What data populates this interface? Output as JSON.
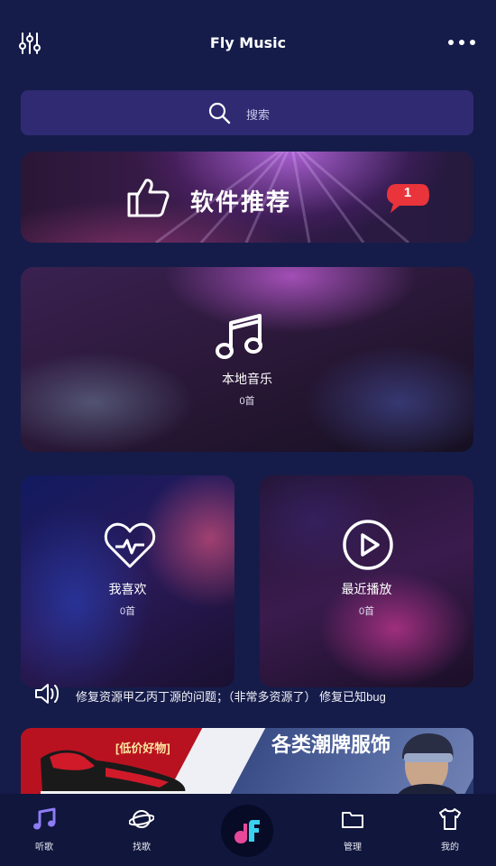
{
  "app": {
    "title": "Fly Music"
  },
  "icons": {
    "equalizer": "equalizer-icon",
    "more": "more-dots-icon",
    "search": "search-icon",
    "thumbs_up": "thumbs-up-icon",
    "music_note": "music-note-icon",
    "heart_pulse": "heart-pulse-icon",
    "play_circle": "play-circle-icon",
    "speaker": "speaker-icon"
  },
  "search": {
    "placeholder": "搜索"
  },
  "banner": {
    "text": "软件推荐",
    "badge": "1",
    "badge_color": "#e8343a"
  },
  "cards": {
    "local": {
      "label": "本地音乐",
      "count": "0首"
    },
    "favorite": {
      "label": "我喜欢",
      "count": "0首"
    },
    "recent": {
      "label": "最近播放",
      "count": "0首"
    }
  },
  "notice": {
    "text": "修复资源甲乙丙丁源的问题；（非常多资源了） 修复已知bug"
  },
  "ad": {
    "tag": "[低价好物]",
    "headline": "各类潮牌服饰"
  },
  "tabs": [
    {
      "label": "听歌",
      "icon": "music-note-icon"
    },
    {
      "label": "找歌",
      "icon": "planet-icon"
    },
    {
      "label": "管理",
      "icon": "folder-icon"
    },
    {
      "label": "我的",
      "icon": "tshirt-icon"
    }
  ],
  "colors": {
    "background": "#151c4a",
    "search_bg": "#2f2a72",
    "tabbar_bg": "#10163c",
    "accent": "#8d7cf5"
  }
}
